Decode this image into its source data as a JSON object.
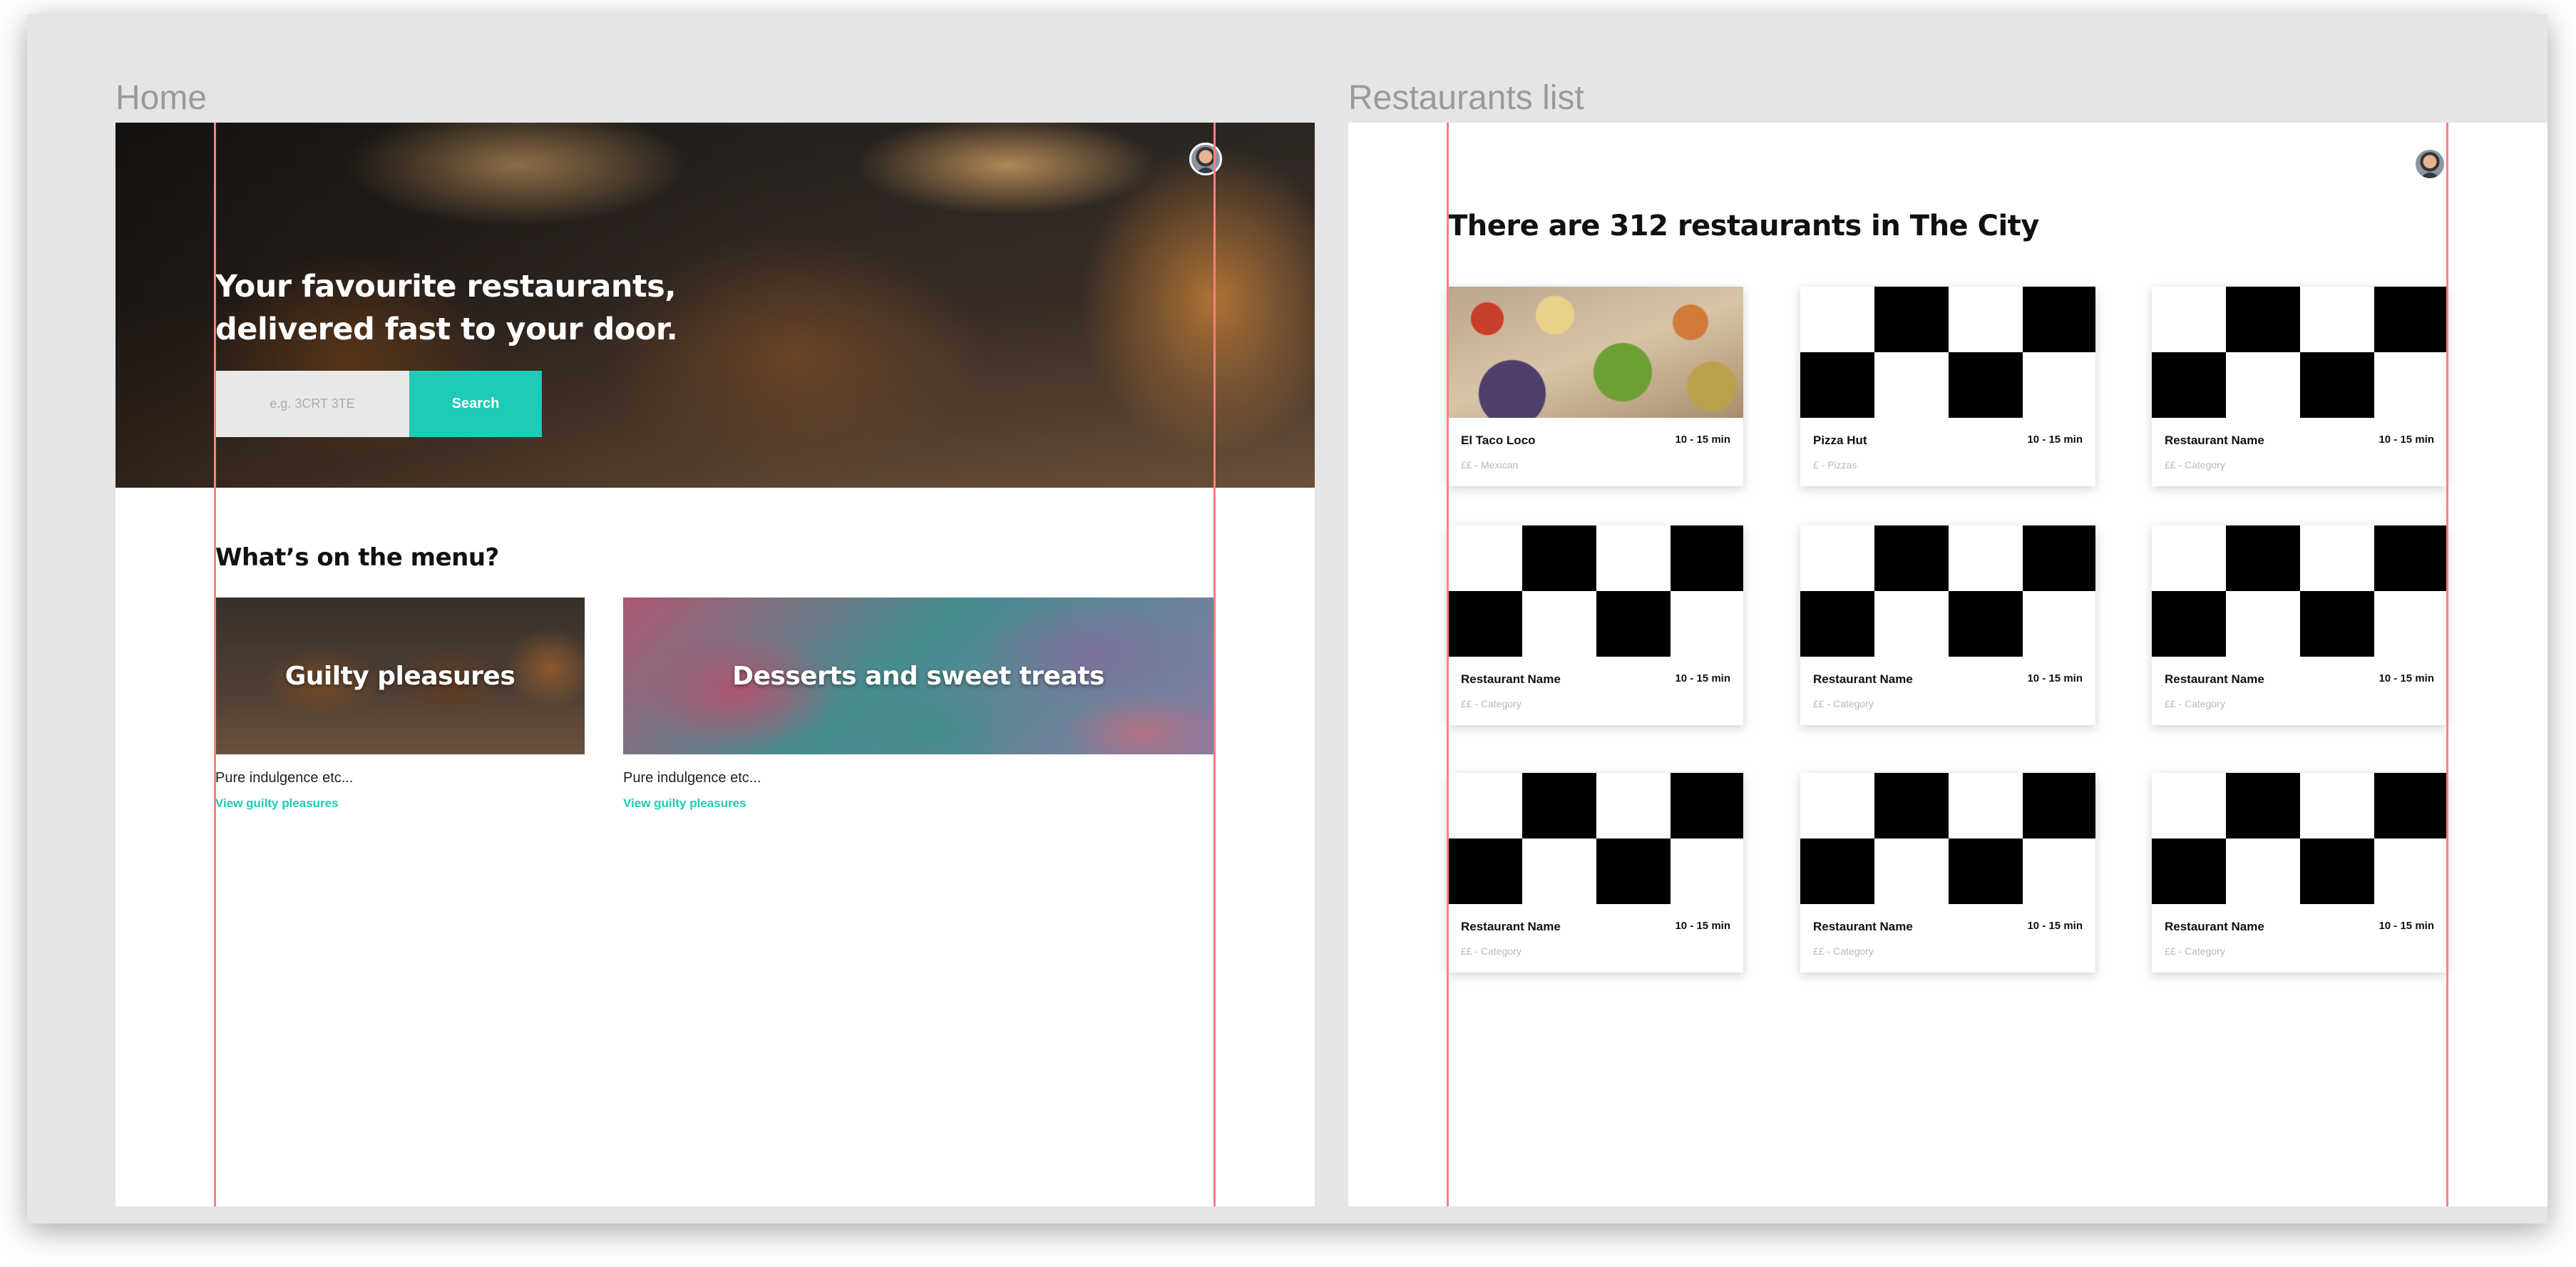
{
  "home": {
    "artboard_title": "Home",
    "hero": {
      "title_line1": "Your favourite restaurants,",
      "title_line2": "delivered fast to your door.",
      "search_placeholder": "e.g. 3CRT 3TE",
      "search_button": "Search"
    },
    "menu": {
      "title": "What’s on the menu?",
      "items": [
        {
          "label": "Guilty pleasures",
          "description": "Pure indulgence etc...",
          "link": "View guilty pleasures"
        },
        {
          "label": "Desserts and sweet treats",
          "description": "Pure indulgence etc...",
          "link": "View guilty pleasures"
        }
      ]
    }
  },
  "list": {
    "artboard_title": "Restaurants list",
    "title": "There are 312 restaurants in The City",
    "restaurants": [
      {
        "name": "El Taco Loco",
        "time": "10 - 15 min",
        "meta": "££ - Mexican",
        "image": "taco-photo"
      },
      {
        "name": "Pizza Hut",
        "time": "10 - 15 min",
        "meta": "£ - Pizzas",
        "image": "placeholder"
      },
      {
        "name": "Restaurant Name",
        "time": "10 - 15 min",
        "meta": "££ - Category",
        "image": "placeholder"
      },
      {
        "name": "Restaurant Name",
        "time": "10 - 15 min",
        "meta": "££ - Category",
        "image": "placeholder"
      },
      {
        "name": "Restaurant Name",
        "time": "10 - 15 min",
        "meta": "££ - Category",
        "image": "placeholder"
      },
      {
        "name": "Restaurant Name",
        "time": "10 - 15 min",
        "meta": "££ - Category",
        "image": "placeholder"
      },
      {
        "name": "Restaurant Name",
        "time": "10 - 15 min",
        "meta": "££ - Category",
        "image": "placeholder"
      },
      {
        "name": "Restaurant Name",
        "time": "10 - 15 min",
        "meta": "££ - Category",
        "image": "placeholder"
      },
      {
        "name": "Restaurant Name",
        "time": "10 - 15 min",
        "meta": "££ - Category",
        "image": "placeholder"
      }
    ]
  },
  "colors": {
    "accent": "#1fcbb8",
    "guide": "#ff7f7f",
    "canvas": "#e5e5e5"
  }
}
